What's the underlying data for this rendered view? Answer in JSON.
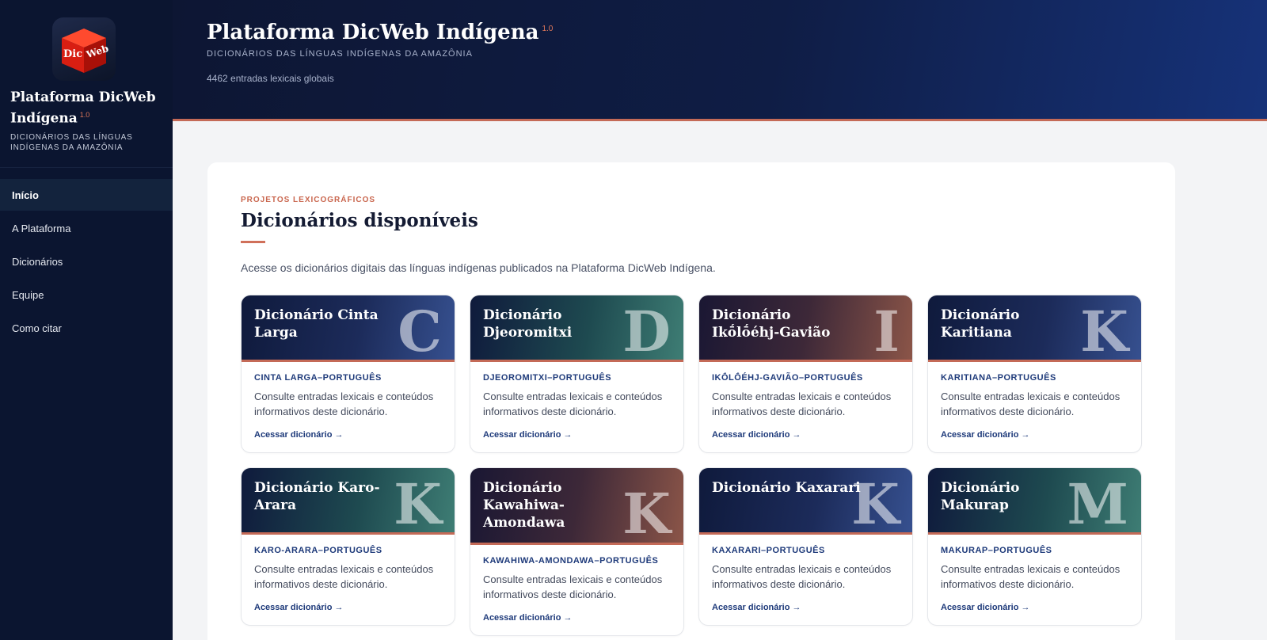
{
  "sidebar": {
    "logo_text_1": "Dic",
    "logo_text_2": "Web",
    "title": "Plataforma DicWeb Indígena",
    "version": "1.0",
    "subtitle": "DICIONÁRIOS DAS LÍNGUAS INDÍGENAS DA AMAZÔNIA",
    "nav": [
      {
        "label": "Início",
        "active": true
      },
      {
        "label": "A Plataforma"
      },
      {
        "label": "Dicionários"
      },
      {
        "label": "Equipe"
      },
      {
        "label": "Como citar"
      }
    ]
  },
  "header": {
    "title": "Plataforma DicWeb Indígena",
    "version": "1.0",
    "subtitle": "DICIONÁRIOS DAS LÍNGUAS INDÍGENAS DA AMAZÔNIA",
    "count": "4462 entradas lexicais globais"
  },
  "main": {
    "eyebrow": "PROJETOS LEXICOGRÁFICOS",
    "title": "Dicionários disponíveis",
    "description": "Acesse os dicionários digitais das línguas indígenas publicados na Plataforma DicWeb Indígena.",
    "cards": [
      {
        "title": "Dicionário Cinta Larga",
        "letter": "C",
        "lang": "CINTA LARGA–PORTUGUÊS",
        "desc": "Consulte entradas lexicais e conteúdos informativos deste dicionário.",
        "link": "Acessar dicionário →"
      },
      {
        "title": "Dicionário Djeoromitxi",
        "letter": "D",
        "lang": "DJEOROMITXI–PORTUGUÊS",
        "desc": "Consulte entradas lexicais e conteúdos informativos deste dicionário.",
        "link": "Acessar dicionário →"
      },
      {
        "title": "Dicionário Ikṓlṓéhj-Gavião",
        "letter": "I",
        "lang": "IKṒLṒÉHJ-GAVIÃO–PORTUGUÊS",
        "desc": "Consulte entradas lexicais e conteúdos informativos deste dicionário.",
        "link": "Acessar dicionário →"
      },
      {
        "title": "Dicionário Karitiana",
        "letter": "K",
        "lang": "KARITIANA–PORTUGUÊS",
        "desc": "Consulte entradas lexicais e conteúdos informativos deste dicionário.",
        "link": "Acessar dicionário →"
      },
      {
        "title": "Dicionário Karo-Arara",
        "letter": "K",
        "lang": "KARO-ARARA–PORTUGUÊS",
        "desc": "Consulte entradas lexicais e conteúdos informativos deste dicionário.",
        "link": "Acessar dicionário →"
      },
      {
        "title": "Dicionário Kawahiwa-Amondawa",
        "letter": "K",
        "lang": "KAWAHIWA-AMONDAWA–PORTUGUÊS",
        "desc": "Consulte entradas lexicais e conteúdos informativos deste dicionário.",
        "link": "Acessar dicionário →"
      },
      {
        "title": "Dicionário Kaxarari",
        "letter": "K",
        "lang": "KAXARARI–PORTUGUÊS",
        "desc": "Consulte entradas lexicais e conteúdos informativos deste dicionário.",
        "link": "Acessar dicionário →"
      },
      {
        "title": "Dicionário Makurap",
        "letter": "M",
        "lang": "MAKURAP–PORTUGUÊS",
        "desc": "Consulte entradas lexicais e conteúdos informativos deste dicionário.",
        "link": "Acessar dicionário →"
      }
    ]
  },
  "colors": {
    "sidebar_bg": "#0b1530",
    "accent": "#c46a57",
    "link": "#1e3a7a"
  }
}
